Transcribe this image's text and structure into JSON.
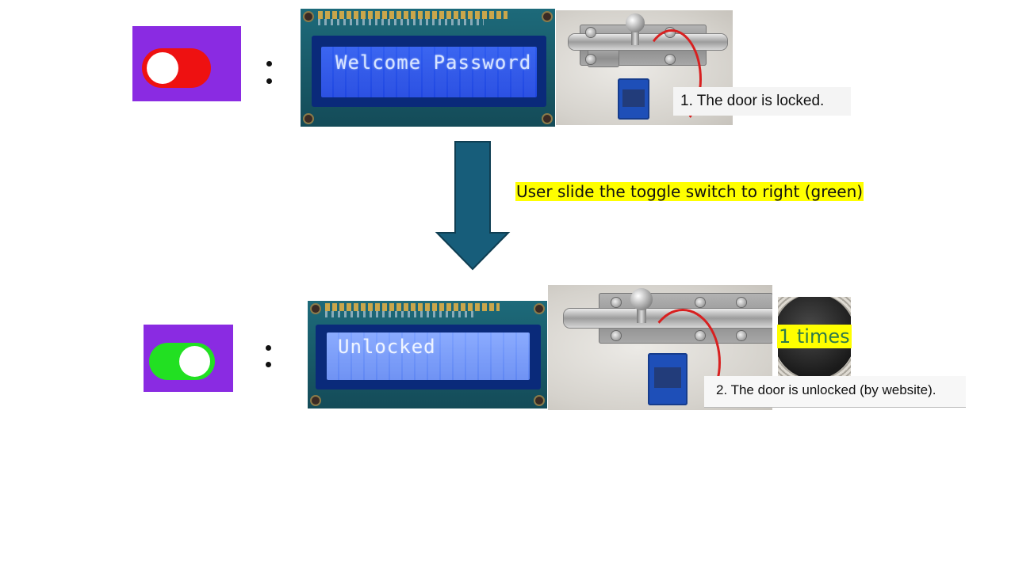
{
  "steps": [
    {
      "toggle": {
        "state": "off",
        "track_color": "#ee1111",
        "tile_color": "#8a2be2"
      },
      "lcd_text": "Welcome Password",
      "caption": "1. The door is locked."
    },
    {
      "toggle": {
        "state": "on",
        "track_color": "#22e022",
        "tile_color": "#8a2be2"
      },
      "lcd_text": "Unlocked",
      "caption": "2. The door is unlocked (by website)."
    }
  ],
  "transition": {
    "label": "User slide the toggle switch to right (green)",
    "arrow_color": "#175d7a"
  },
  "counter": {
    "text": "1 times"
  }
}
